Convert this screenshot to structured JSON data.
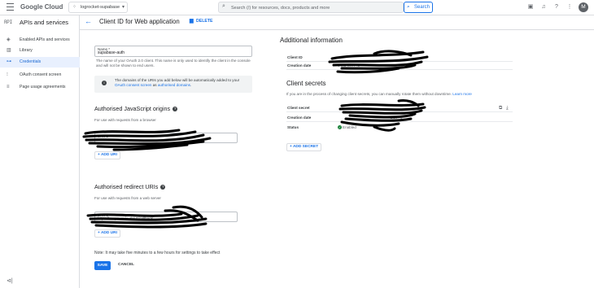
{
  "topbar": {
    "brand": "Google Cloud",
    "project": "logrocket-supabase",
    "search_placeholder": "Search (/) for resources, docs, products and more",
    "search_button": "Search",
    "avatar_initial": "M"
  },
  "sidebar": {
    "api_badge": "RPI",
    "title": "APIs and services",
    "items": [
      {
        "label": "Enabled APIs and services",
        "icon": "grid-icon",
        "active": false
      },
      {
        "label": "Library",
        "icon": "library-icon",
        "active": false
      },
      {
        "label": "Credentials",
        "icon": "key-icon",
        "active": true
      },
      {
        "label": "OAuth consent screen",
        "icon": "consent-icon",
        "active": false
      },
      {
        "label": "Page usage agreements",
        "icon": "settings-list-icon",
        "active": false
      }
    ]
  },
  "header": {
    "title": "Client ID for Web application",
    "delete_label": "DELETE"
  },
  "form": {
    "name_label": "Name *",
    "name_value": "supabase-auth",
    "name_hint": "The name of your OAuth 2.0 client. This name is only used to identify the client in the console and will not be shown to end users.",
    "info_text": "The domains of the URIs you add below will be automatically added to your ",
    "info_link1": "OAuth consent screen",
    "info_mid": " as ",
    "info_link2": "authorised domains",
    "info_end": ".",
    "js_origins_title": "Authorised JavaScript origins",
    "js_origins_hint": "For use with requests from a browser",
    "js_origin_label": "URIs 1 *",
    "add_uri_label": "+ ADD URI",
    "redirect_title": "Authorised redirect URIs",
    "redirect_hint": "For use with requests from a web server",
    "redirect_label": "URIs 1 *",
    "redirect_value": "https://        .supa      .co/auth/v1/callback",
    "note": "Note: It may take five minutes to a few hours for settings to take effect",
    "save_label": "SAVE",
    "cancel_label": "CANCEL"
  },
  "additional_info": {
    "title": "Additional information",
    "client_id_label": "Client ID",
    "creation_date_label": "Creation date",
    "creation_date_value": "6 Ma            GMT+5"
  },
  "client_secrets": {
    "title": "Client secrets",
    "description": "If you are in the process of changing client secrets, you can manually rotate them without downtime. ",
    "learn_more": "Learn more",
    "secret_label": "Client secret",
    "creation_date_label": "Creation date",
    "creation_date_value": "GMT+5",
    "status_label": "Status",
    "status_value": "Enabled",
    "add_secret_label": "+ ADD SECRET"
  },
  "colors": {
    "accent": "#1a73e8",
    "active_bg": "#e8f0fe",
    "enabled_green": "#188038",
    "redaction": "#000000"
  }
}
